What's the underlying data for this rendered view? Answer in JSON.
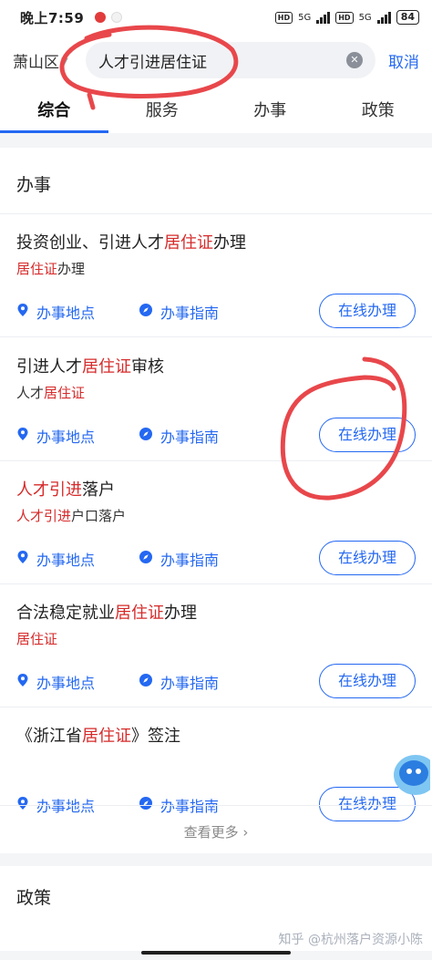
{
  "status": {
    "time": "晚上7:59",
    "net1": "5G",
    "net2": "5G",
    "battery": "84"
  },
  "search": {
    "district": "萧山区",
    "query": "人才引进居住证",
    "cancel": "取消"
  },
  "tabs": [
    "综合",
    "服务",
    "办事",
    "政策"
  ],
  "section_banshi": {
    "title": "办事",
    "more": "查看更多"
  },
  "items": [
    {
      "title_pre": "投资创业、引进人才",
      "title_hl": "居住证",
      "title_post": "办理",
      "sub_pre": "",
      "sub_hl": "居住证",
      "sub_post": "办理"
    },
    {
      "title_pre": "引进人才",
      "title_hl": "居住证",
      "title_post": "审核",
      "sub_pre": "人才",
      "sub_hl": "居住证",
      "sub_post": ""
    },
    {
      "title_pre": "",
      "title_hl": "人才引进",
      "title_post": "落户",
      "sub_pre": "",
      "sub_hl": "人才引进",
      "sub_post": "户口落户"
    },
    {
      "title_pre": "合法稳定就业",
      "title_hl": "居住证",
      "title_post": "办理",
      "sub_pre": "",
      "sub_hl": "居住证",
      "sub_post": ""
    },
    {
      "title_pre": "《浙江省",
      "title_hl": "居住证",
      "title_post": "》签注",
      "sub_pre": "",
      "sub_hl": "",
      "sub_post": ""
    }
  ],
  "actions": {
    "location": "办事地点",
    "guide": "办事指南",
    "online": "在线办理"
  },
  "section_policy": {
    "title": "政策"
  },
  "watermark": "知乎 @杭州落户资源小陈",
  "colors": {
    "accent": "#2468f2",
    "highlight": "#d62a2a",
    "annotation": "#e8474b"
  }
}
